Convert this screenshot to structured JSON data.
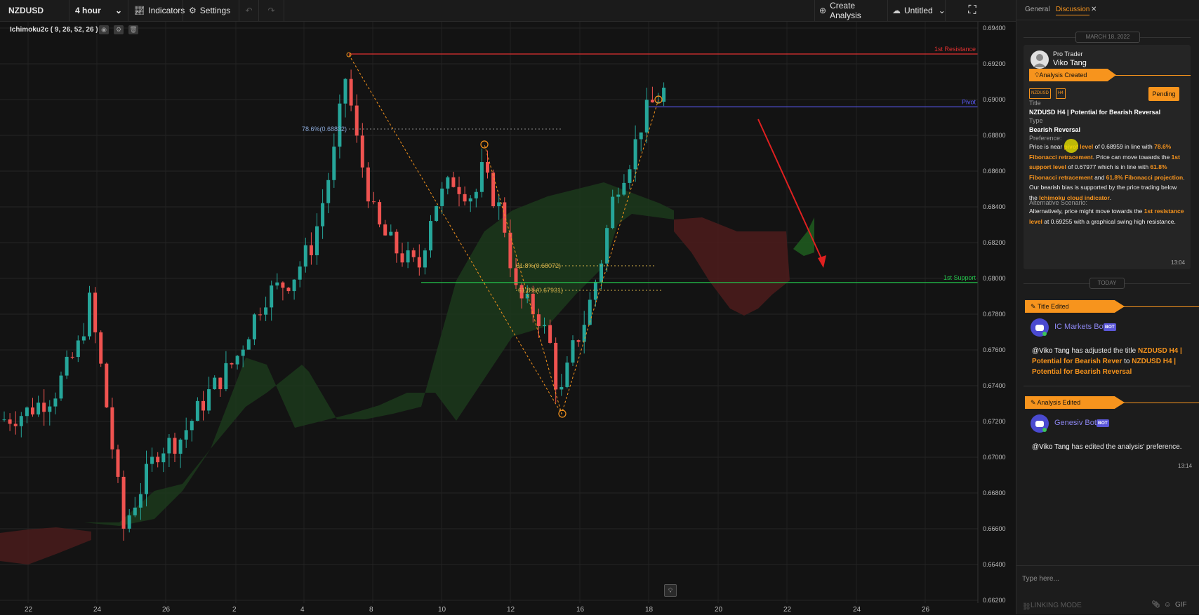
{
  "toolbar": {
    "symbol": "NZDUSD",
    "interval": "4 hour",
    "indicators_label": "Indicators",
    "settings_label": "Settings",
    "create_analysis_label": "Create Analysis",
    "untitled_label": "Untitled"
  },
  "indicator": {
    "label": "Ichimoku2c ( 9, 26, 52, 26 )"
  },
  "chart": {
    "y_ticks": [
      "0.69400",
      "0.69200",
      "0.69000",
      "0.68800",
      "0.68600",
      "0.68400",
      "0.68200",
      "0.68000",
      "0.67800",
      "0.67600",
      "0.67400",
      "0.67200",
      "0.67000",
      "0.66800",
      "0.66600",
      "0.66400",
      "0.66200"
    ],
    "x_ticks": [
      "22",
      "24",
      "26",
      "2",
      "4",
      "8",
      "10",
      "12",
      "16",
      "18",
      "20",
      "22",
      "24",
      "26"
    ],
    "levels": [
      {
        "name": "1st Resistance",
        "price": "0.69255",
        "color": "#e03030"
      },
      {
        "name": "Pivot",
        "price": "0.68959",
        "color": "#5c5cff"
      },
      {
        "name": "1st Support",
        "price": "0.67977",
        "color": "#22c04a"
      }
    ],
    "current_price": "0.69066",
    "fib_labels": {
      "fib_786": "78.6%(0.68832)",
      "fib_618": "61.8%(0.68072)",
      "fib_618b": "61.8%(0.67931)"
    }
  },
  "chart_data": {
    "type": "candlestick",
    "symbol": "NZDUSD",
    "interval": "4 hour",
    "y_range": [
      0.662,
      0.694
    ],
    "x_labels": [
      "22",
      "24",
      "26",
      "2",
      "4",
      "8",
      "10",
      "12",
      "16",
      "18",
      "20",
      "22",
      "24",
      "26"
    ],
    "levels": {
      "1st Resistance": 0.69255,
      "Pivot": 0.68959,
      "1st Support": 0.67977
    },
    "fibonacci": {
      "78.6%": 0.68832,
      "61.8%": 0.68072,
      "61.8% projection": 0.67931
    }
  },
  "panel": {
    "tab_general": "General",
    "tab_discussion": "Discussion",
    "date_label": "MARCH 18, 2022",
    "today_label": "TODAY",
    "author_role": "Pro Trader",
    "author_name": "Viko Tang",
    "event_created": "Analysis Created",
    "chip_symbol": "NZDUSD",
    "chip_tf": "H4",
    "status": "Pending",
    "title_label": "Title",
    "title_value": "NZDUSD H4 | Potential for Bearish Reversal",
    "type_label": "Type",
    "type_value": "Bearish Reversal",
    "preference_label": "Preference:",
    "preference": {
      "t1": "Price is near ",
      "h1": "pivot level",
      "t2": " of 0.68959 in line with ",
      "h2": "78.6% Fibonacci retracement",
      "t3": ". Price can move towards the ",
      "h3": "1st support level",
      "t4": " of 0.67977 which is in line with ",
      "h4": "61.8% Fibonacci retracement",
      "t5": " and ",
      "h5": "61.8% Fibonacci projection",
      "t6": ". Our bearish bias is supported by the price trading below the ",
      "h6": "Ichimoku cloud indicator",
      "t7": "."
    },
    "alt_label": "Alternative Scenario:",
    "alternative": {
      "t1": "Alternatively, price might move towards the ",
      "h1": "1st resistance level",
      "t2": " at 0.69255 with a graphical swing high resistance."
    },
    "card_time": "13:04",
    "event_title": "Title Edited",
    "bot1_name": "IC Markets Bot",
    "bot_badge": "BOT",
    "msg1": {
      "mention": "@Viko Tang",
      "t1": " has adjusted the title ",
      "h1": "NZDUSD H4 | Potential for Bearish Rever",
      "t2": " to ",
      "h2": "NZDUSD H4 | Potential for Bearish Reversal"
    },
    "event_edited": "Analysis Edited",
    "bot2_name": "Genesiv Bot",
    "msg2": {
      "mention": "@Viko Tang",
      "t1": " has edited the analysis' preference."
    },
    "msg2_time": "13:14",
    "input_placeholder": "Type here...",
    "linking_mode": "LINKING MODE",
    "gif_label": "GIF"
  }
}
